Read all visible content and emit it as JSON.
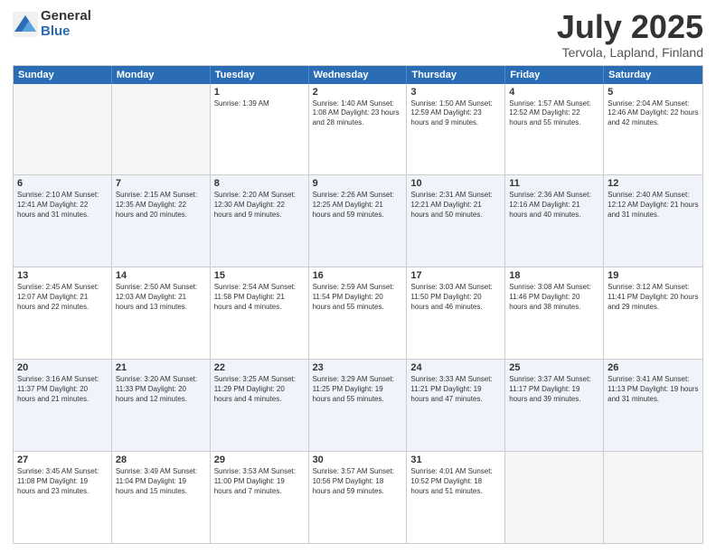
{
  "header": {
    "logo_general": "General",
    "logo_blue": "Blue",
    "month_title": "July 2025",
    "location": "Tervola, Lapland, Finland"
  },
  "calendar": {
    "days_of_week": [
      "Sunday",
      "Monday",
      "Tuesday",
      "Wednesday",
      "Thursday",
      "Friday",
      "Saturday"
    ],
    "rows": [
      [
        {
          "day": "",
          "text": ""
        },
        {
          "day": "",
          "text": ""
        },
        {
          "day": "1",
          "text": "Sunrise: 1:39 AM"
        },
        {
          "day": "2",
          "text": "Sunrise: 1:40 AM\nSunset: 1:08 AM\nDaylight: 23 hours and 28 minutes."
        },
        {
          "day": "3",
          "text": "Sunrise: 1:50 AM\nSunset: 12:59 AM\nDaylight: 23 hours and 9 minutes."
        },
        {
          "day": "4",
          "text": "Sunrise: 1:57 AM\nSunset: 12:52 AM\nDaylight: 22 hours and 55 minutes."
        },
        {
          "day": "5",
          "text": "Sunrise: 2:04 AM\nSunset: 12:46 AM\nDaylight: 22 hours and 42 minutes."
        }
      ],
      [
        {
          "day": "6",
          "text": "Sunrise: 2:10 AM\nSunset: 12:41 AM\nDaylight: 22 hours and 31 minutes."
        },
        {
          "day": "7",
          "text": "Sunrise: 2:15 AM\nSunset: 12:35 AM\nDaylight: 22 hours and 20 minutes."
        },
        {
          "day": "8",
          "text": "Sunrise: 2:20 AM\nSunset: 12:30 AM\nDaylight: 22 hours and 9 minutes."
        },
        {
          "day": "9",
          "text": "Sunrise: 2:26 AM\nSunset: 12:25 AM\nDaylight: 21 hours and 59 minutes."
        },
        {
          "day": "10",
          "text": "Sunrise: 2:31 AM\nSunset: 12:21 AM\nDaylight: 21 hours and 50 minutes."
        },
        {
          "day": "11",
          "text": "Sunrise: 2:36 AM\nSunset: 12:16 AM\nDaylight: 21 hours and 40 minutes."
        },
        {
          "day": "12",
          "text": "Sunrise: 2:40 AM\nSunset: 12:12 AM\nDaylight: 21 hours and 31 minutes."
        }
      ],
      [
        {
          "day": "13",
          "text": "Sunrise: 2:45 AM\nSunset: 12:07 AM\nDaylight: 21 hours and 22 minutes."
        },
        {
          "day": "14",
          "text": "Sunrise: 2:50 AM\nSunset: 12:03 AM\nDaylight: 21 hours and 13 minutes."
        },
        {
          "day": "15",
          "text": "Sunrise: 2:54 AM\nSunset: 11:58 PM\nDaylight: 21 hours and 4 minutes."
        },
        {
          "day": "16",
          "text": "Sunrise: 2:59 AM\nSunset: 11:54 PM\nDaylight: 20 hours and 55 minutes."
        },
        {
          "day": "17",
          "text": "Sunrise: 3:03 AM\nSunset: 11:50 PM\nDaylight: 20 hours and 46 minutes."
        },
        {
          "day": "18",
          "text": "Sunrise: 3:08 AM\nSunset: 11:46 PM\nDaylight: 20 hours and 38 minutes."
        },
        {
          "day": "19",
          "text": "Sunrise: 3:12 AM\nSunset: 11:41 PM\nDaylight: 20 hours and 29 minutes."
        }
      ],
      [
        {
          "day": "20",
          "text": "Sunrise: 3:16 AM\nSunset: 11:37 PM\nDaylight: 20 hours and 21 minutes."
        },
        {
          "day": "21",
          "text": "Sunrise: 3:20 AM\nSunset: 11:33 PM\nDaylight: 20 hours and 12 minutes."
        },
        {
          "day": "22",
          "text": "Sunrise: 3:25 AM\nSunset: 11:29 PM\nDaylight: 20 hours and 4 minutes."
        },
        {
          "day": "23",
          "text": "Sunrise: 3:29 AM\nSunset: 11:25 PM\nDaylight: 19 hours and 55 minutes."
        },
        {
          "day": "24",
          "text": "Sunrise: 3:33 AM\nSunset: 11:21 PM\nDaylight: 19 hours and 47 minutes."
        },
        {
          "day": "25",
          "text": "Sunrise: 3:37 AM\nSunset: 11:17 PM\nDaylight: 19 hours and 39 minutes."
        },
        {
          "day": "26",
          "text": "Sunrise: 3:41 AM\nSunset: 11:13 PM\nDaylight: 19 hours and 31 minutes."
        }
      ],
      [
        {
          "day": "27",
          "text": "Sunrise: 3:45 AM\nSunset: 11:08 PM\nDaylight: 19 hours and 23 minutes."
        },
        {
          "day": "28",
          "text": "Sunrise: 3:49 AM\nSunset: 11:04 PM\nDaylight: 19 hours and 15 minutes."
        },
        {
          "day": "29",
          "text": "Sunrise: 3:53 AM\nSunset: 11:00 PM\nDaylight: 19 hours and 7 minutes."
        },
        {
          "day": "30",
          "text": "Sunrise: 3:57 AM\nSunset: 10:56 PM\nDaylight: 18 hours and 59 minutes."
        },
        {
          "day": "31",
          "text": "Sunrise: 4:01 AM\nSunset: 10:52 PM\nDaylight: 18 hours and 51 minutes."
        },
        {
          "day": "",
          "text": ""
        },
        {
          "day": "",
          "text": ""
        }
      ]
    ]
  }
}
